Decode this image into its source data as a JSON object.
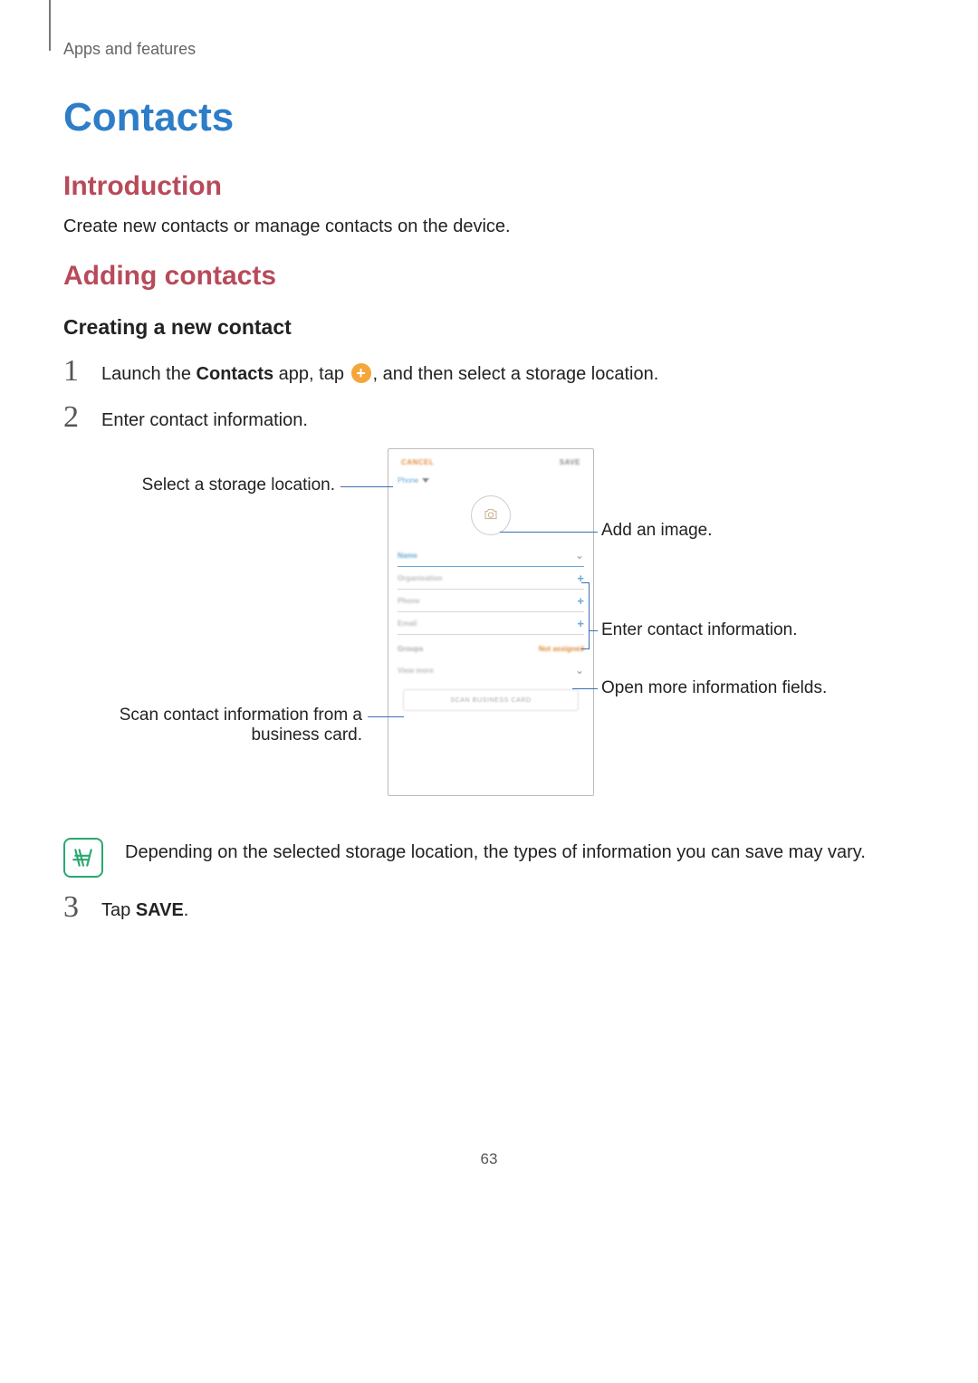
{
  "breadcrumb": "Apps and features",
  "title": "Contacts",
  "sections": {
    "intro_h": "Introduction",
    "intro_p": "Create new contacts or manage contacts on the device.",
    "adding_h": "Adding contacts",
    "creating_h": "Creating a new contact"
  },
  "steps": {
    "s1a": "Launch the ",
    "s1b": "Contacts",
    "s1c": " app, tap ",
    "s1d": ", and then select a storage location.",
    "s2": "Enter contact information.",
    "s3a": "Tap ",
    "s3b": "SAVE",
    "s3c": "."
  },
  "callouts": {
    "storage": "Select a storage location.",
    "image": "Add an image.",
    "fields": "Enter contact information.",
    "more": "Open more information fields.",
    "scan1": "Scan contact information from a",
    "scan2": "business card."
  },
  "phone": {
    "cancel": "CANCEL",
    "save": "SAVE",
    "storage": "Phone",
    "name": "Name",
    "org": "Organisation",
    "phone": "Phone",
    "email": "Email",
    "groups": "Groups",
    "na": "Not assigned",
    "more": "View more",
    "scan": "SCAN BUSINESS CARD"
  },
  "note": "Depending on the selected storage location, the types of information you can save may vary.",
  "page_number": "63"
}
